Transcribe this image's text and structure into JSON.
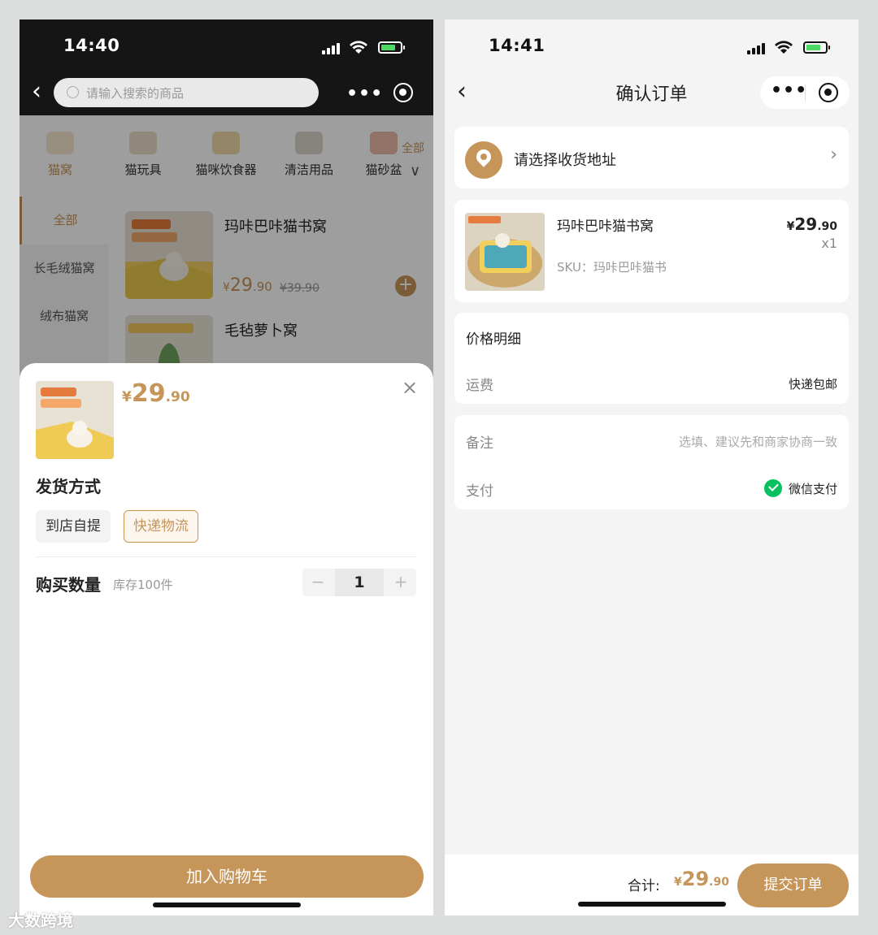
{
  "left": {
    "status": {
      "time": "14:40"
    },
    "search": {
      "placeholder": "请输入搜索的商品"
    },
    "categories": [
      {
        "label": "猫窝"
      },
      {
        "label": "猫玩具"
      },
      {
        "label": "猫咪饮食器"
      },
      {
        "label": "清洁用品"
      },
      {
        "label": "猫砂盆"
      }
    ],
    "all_label": "全部",
    "side_menu": [
      {
        "label": "全部"
      },
      {
        "label": "长毛绒猫窝"
      },
      {
        "label": "绒布猫窝"
      }
    ],
    "products": [
      {
        "title": "玛咔巴咔猫书窝",
        "price_yen": "¥",
        "price_int": "29",
        "price_dec": ".90",
        "old_price": "¥39.90"
      },
      {
        "title": "毛毡萝卜窝"
      }
    ],
    "sheet": {
      "price_yen": "¥",
      "price_int": "29",
      "price_dec": ".90",
      "close": "×",
      "shipping_title": "发货方式",
      "shipping_options": [
        "到店自提",
        "快递物流"
      ],
      "qty_label": "购买数量",
      "stock": "库存100件",
      "qty": "1",
      "minus": "−",
      "plus": "+",
      "add_to_cart": "加入购物车"
    }
  },
  "right": {
    "status": {
      "time": "14:41"
    },
    "title": "确认订单",
    "address_prompt": "请选择收货地址",
    "item": {
      "title": "玛咔巴咔猫书窝",
      "sku": "SKU：玛咔巴咔猫书",
      "price_yen": "¥",
      "price_int": "29",
      "price_dec": ".90",
      "qty": "x1"
    },
    "price_detail": {
      "title": "价格明细",
      "shipping_key": "运费",
      "shipping_value": "快递包邮"
    },
    "note": {
      "key": "备注",
      "placeholder": "选填、建议先和商家协商一致"
    },
    "payment": {
      "key": "支付",
      "value": "微信支付"
    },
    "footer": {
      "total_label": "合计:",
      "price_yen": "¥",
      "price_int": "29",
      "price_dec": ".90",
      "submit": "提交订单"
    }
  },
  "watermark": "大数跨境",
  "colors": {
    "accent": "#c6955a",
    "wechat": "#07c160"
  }
}
